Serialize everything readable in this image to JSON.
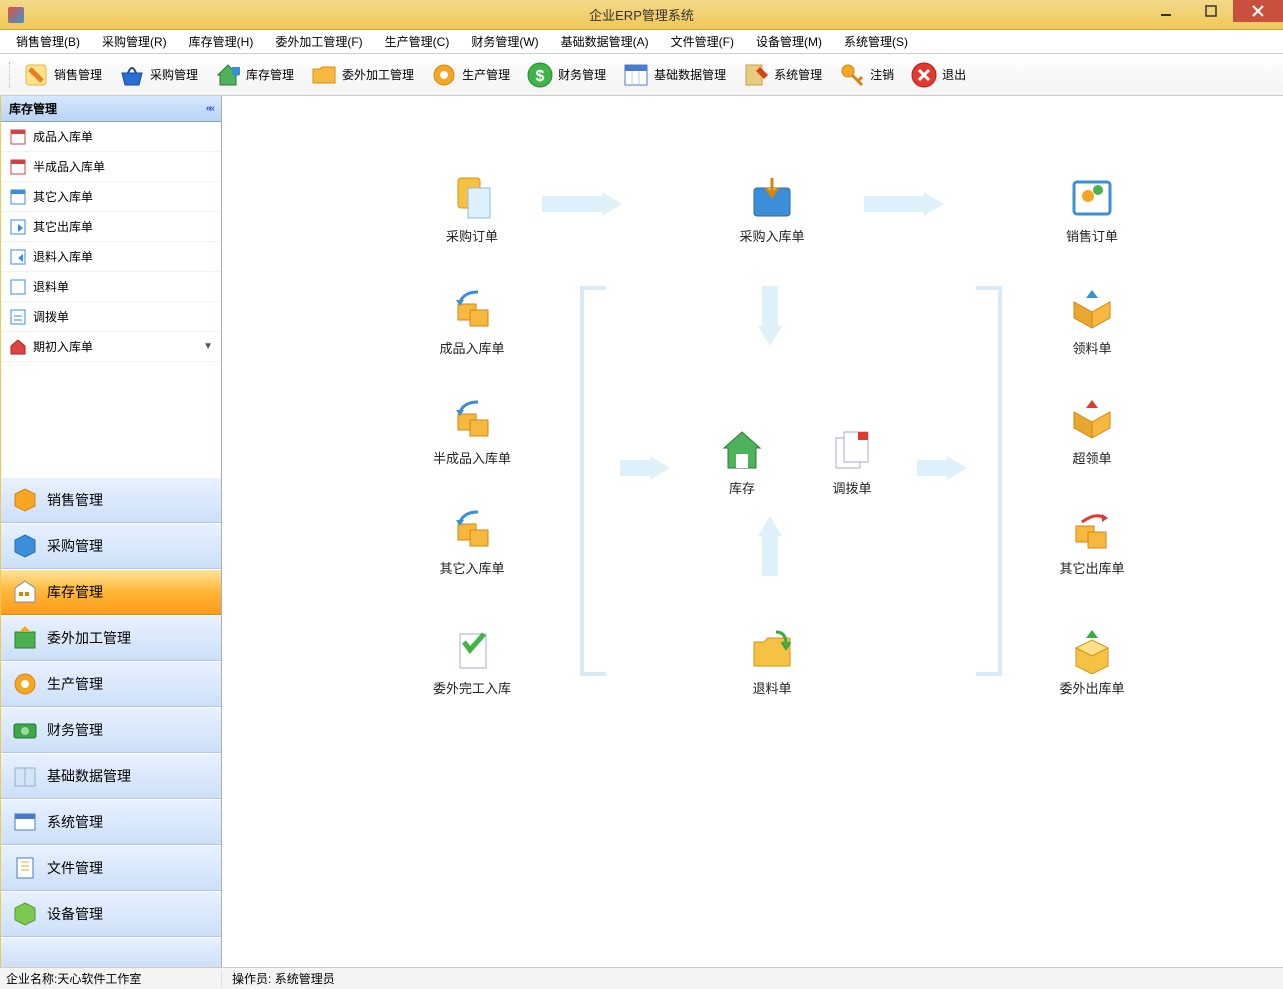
{
  "window": {
    "title": "企业ERP管理系统"
  },
  "menu": [
    "销售管理(B)",
    "采购管理(R)",
    "库存管理(H)",
    "委外加工管理(F)",
    "生产管理(C)",
    "财务管理(W)",
    "基础数据管理(A)",
    "文件管理(F)",
    "设备管理(M)",
    "系统管理(S)"
  ],
  "toolbar": [
    {
      "name": "sales",
      "label": "销售管理"
    },
    {
      "name": "purchase",
      "label": "采购管理"
    },
    {
      "name": "inventory",
      "label": "库存管理"
    },
    {
      "name": "outsource",
      "label": "委外加工管理"
    },
    {
      "name": "production",
      "label": "生产管理"
    },
    {
      "name": "finance",
      "label": "财务管理"
    },
    {
      "name": "basedata",
      "label": "基础数据管理"
    },
    {
      "name": "system",
      "label": "系统管理"
    },
    {
      "name": "logout",
      "label": "注销"
    },
    {
      "name": "exit",
      "label": "退出"
    }
  ],
  "sidebar": {
    "header": "库存管理",
    "items": [
      "成品入库单",
      "半成品入库单",
      "其它入库单",
      "其它出库单",
      "退料入库单",
      "退料单",
      "调拨单",
      "期初入库单"
    ],
    "accordion": [
      {
        "name": "sales",
        "label": "销售管理"
      },
      {
        "name": "purchase",
        "label": "采购管理"
      },
      {
        "name": "inventory",
        "label": "库存管理",
        "active": true
      },
      {
        "name": "outsource",
        "label": "委外加工管理"
      },
      {
        "name": "production",
        "label": "生产管理"
      },
      {
        "name": "finance",
        "label": "财务管理"
      },
      {
        "name": "basedata",
        "label": "基础数据管理"
      },
      {
        "name": "system",
        "label": "系统管理"
      },
      {
        "name": "files",
        "label": "文件管理"
      },
      {
        "name": "device",
        "label": "设备管理"
      }
    ]
  },
  "flow": {
    "row1": [
      {
        "name": "purchase-order",
        "label": "采购订单"
      },
      {
        "name": "purchase-in",
        "label": "采购入库单"
      },
      {
        "name": "sales-order",
        "label": "销售订单"
      }
    ],
    "col_left": [
      {
        "name": "finished-in",
        "label": "成品入库单"
      },
      {
        "name": "semi-in",
        "label": "半成品入库单"
      },
      {
        "name": "other-in",
        "label": "其它入库单"
      },
      {
        "name": "outsource-done-in",
        "label": "委外完工入库"
      }
    ],
    "center": [
      {
        "name": "store",
        "label": "库存"
      },
      {
        "name": "transfer",
        "label": "调拨单"
      },
      {
        "name": "return-material",
        "label": "退料单"
      }
    ],
    "col_right": [
      {
        "name": "pick",
        "label": "领料单"
      },
      {
        "name": "overpick",
        "label": "超领单"
      },
      {
        "name": "other-out",
        "label": "其它出库单"
      },
      {
        "name": "outsource-out",
        "label": "委外出库单"
      }
    ]
  },
  "status": {
    "company_label": "企业名称:",
    "company_value": "天心软件工作室",
    "operator_label": "操作员:",
    "operator_value": "系统管理员"
  }
}
